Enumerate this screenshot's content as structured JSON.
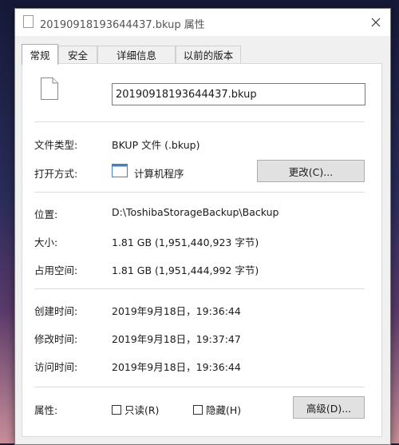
{
  "window": {
    "title": "20190918193644437.bkup 属性"
  },
  "tabs": [
    {
      "label": "常规"
    },
    {
      "label": "安全"
    },
    {
      "label": "详细信息"
    },
    {
      "label": "以前的版本"
    }
  ],
  "general": {
    "filename": "20190918193644437.bkup",
    "file_type_label": "文件类型:",
    "file_type_value": "BKUP 文件 (.bkup)",
    "open_with_label": "打开方式:",
    "open_with_value": "计算机程序",
    "change_button": "更改(C)...",
    "location_label": "位置:",
    "location_value": "D:\\ToshibaStorageBackup\\Backup",
    "size_label": "大小:",
    "size_value": "1.81 GB (1,951,440,923 字节)",
    "size_on_disk_label": "占用空间:",
    "size_on_disk_value": "1.81 GB (1,951,444,992 字节)",
    "created_label": "创建时间:",
    "created_value": "2019年9月18日，19:36:44",
    "modified_label": "修改时间:",
    "modified_value": "2019年9月18日，19:37:47",
    "accessed_label": "访问时间:",
    "accessed_value": "2019年9月18日，19:36:44",
    "attributes_label": "属性:",
    "readonly_label": "只读(R)",
    "readonly_checked": false,
    "hidden_label": "隐藏(H)",
    "hidden_checked": false,
    "advanced_button": "高级(D)..."
  }
}
